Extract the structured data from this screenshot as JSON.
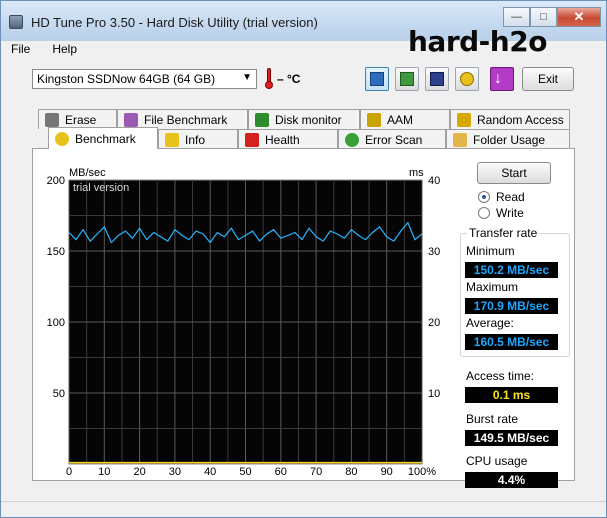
{
  "window": {
    "title": "HD Tune Pro 3.50 - Hard Disk Utility (trial version)",
    "controls": {
      "minimize": "0",
      "maximize": "1",
      "close": "r"
    }
  },
  "menu": [
    {
      "label": "File"
    },
    {
      "label": "Help"
    }
  ],
  "brand": {
    "text": "hard-h2o"
  },
  "toolbar": {
    "drive": "Kingston SSDNow 64GB (64 GB)",
    "temperature": "– °C",
    "exit_label": "Exit",
    "icons": [
      "copy-icon",
      "copy-all-icon",
      "save-icon",
      "options-icon",
      "exit-down-icon"
    ]
  },
  "tabs_row1": [
    {
      "label": "Erase",
      "icon": "trash-icon",
      "color": "#777777"
    },
    {
      "label": "File Benchmark",
      "icon": "file-benchmark-icon",
      "color": "#9a5bb0"
    },
    {
      "label": "Disk monitor",
      "icon": "disk-monitor-icon",
      "color": "#2e8b2e"
    },
    {
      "label": "AAM",
      "icon": "speaker-icon",
      "color": "#c8a400"
    },
    {
      "label": "Random Access",
      "icon": "random-access-icon",
      "color": "#d4a800"
    }
  ],
  "tabs_row2": [
    {
      "label": "Benchmark",
      "icon": "lightbulb-icon",
      "color": "#e7c21b"
    },
    {
      "label": "Info",
      "icon": "info-icon",
      "color": "#e7c21b"
    },
    {
      "label": "Health",
      "icon": "health-cross-icon",
      "color": "#d52020"
    },
    {
      "label": "Error Scan",
      "icon": "magnifier-icon",
      "color": "#3aa03a"
    },
    {
      "label": "Folder Usage",
      "icon": "folder-icon",
      "color": "#e3b64a"
    }
  ],
  "side": {
    "start_label": "Start",
    "read_label": "Read",
    "write_label": "Write",
    "mode": "read",
    "transfer_rate_label": "Transfer rate",
    "minimum_label": "Minimum",
    "minimum_value": "150.2 MB/sec",
    "maximum_label": "Maximum",
    "maximum_value": "170.9 MB/sec",
    "average_label": "Average:",
    "average_value": "160.5 MB/sec",
    "access_time_label": "Access time:",
    "access_time_value": "0.1 ms",
    "burst_rate_label": "Burst rate",
    "burst_rate_value": "149.5 MB/sec",
    "cpu_usage_label": "CPU usage",
    "cpu_usage_value": "4.4%"
  },
  "chart_data": {
    "type": "line",
    "title": "",
    "watermark": "trial version",
    "ylabel_left": "MB/sec",
    "ylabel_right": "ms",
    "xlim": [
      0,
      100
    ],
    "ylim_left": [
      0,
      200
    ],
    "ylim_right": [
      0,
      40
    ],
    "x_ticks": [
      "0",
      "10",
      "20",
      "30",
      "40",
      "50",
      "60",
      "70",
      "80",
      "90",
      "100%"
    ],
    "y_ticks_left": [
      "200",
      "150",
      "100",
      "50"
    ],
    "y_ticks_right": [
      "40",
      "30",
      "20",
      "10"
    ],
    "grid": true,
    "series": [
      {
        "color": "#27b4ff",
        "x": [
          0,
          2,
          4,
          6,
          8,
          10,
          12,
          14,
          16,
          18,
          20,
          22,
          24,
          26,
          28,
          30,
          32,
          34,
          36,
          38,
          40,
          42,
          44,
          46,
          48,
          50,
          52,
          54,
          56,
          58,
          60,
          62,
          64,
          66,
          68,
          70,
          72,
          74,
          76,
          78,
          80,
          82,
          84,
          86,
          88,
          90,
          92,
          94,
          96,
          98,
          100
        ],
        "values": [
          163,
          158,
          165,
          157,
          162,
          167,
          156,
          161,
          164,
          159,
          166,
          158,
          163,
          160,
          157,
          165,
          161,
          158,
          164,
          162,
          156,
          163,
          160,
          166,
          158,
          161,
          164,
          157,
          162,
          165,
          159,
          161,
          163,
          158,
          166,
          160,
          157,
          164,
          162,
          159,
          165,
          161,
          158,
          163,
          167,
          160,
          157,
          164,
          170,
          158,
          162
        ]
      },
      {
        "color": "#ffd21a",
        "x": [
          0,
          10,
          20,
          30,
          40,
          50,
          60,
          70,
          80,
          90,
          100
        ],
        "values": [
          1,
          1,
          1,
          1,
          1,
          1,
          1,
          1,
          1,
          1,
          1
        ]
      }
    ]
  }
}
